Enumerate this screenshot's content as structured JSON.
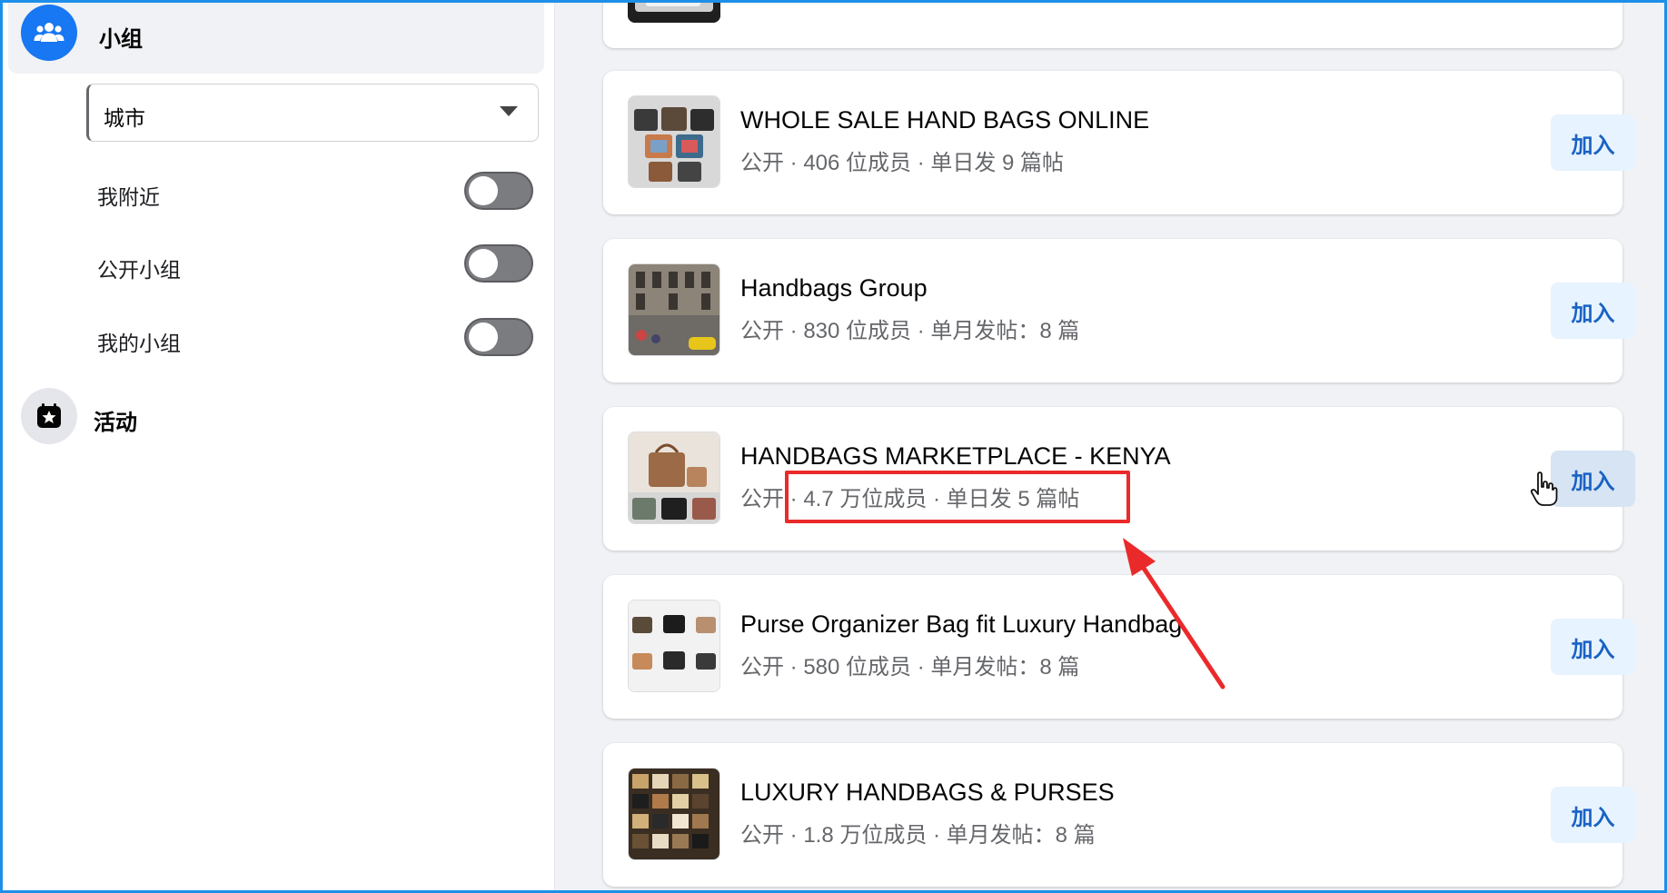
{
  "sidebar": {
    "groups": {
      "label": "小组",
      "icon": "groups-icon"
    },
    "city_filter": {
      "value": "城市",
      "icon": "caret-down-icon"
    },
    "toggles": [
      {
        "label": "我附近",
        "on": false
      },
      {
        "label": "公开小组",
        "on": false
      },
      {
        "label": "我的小组",
        "on": false
      }
    ],
    "events": {
      "label": "活动",
      "icon": "calendar-star-icon"
    }
  },
  "results": [
    {
      "title": "WHOLE SALE HAND BAGS ONLINE",
      "meta": "公开 · 406 位成员 · 单日发 9 篇帖",
      "join": "加入"
    },
    {
      "title": "Handbags Group",
      "meta": "公开 · 830 位成员 · 单月发帖：8 篇",
      "join": "加入"
    },
    {
      "title": "HANDBAGS MARKETPLACE - KENYA",
      "meta": "公开 · 4.7 万位成员 · 单日发 5 篇帖",
      "join": "加入"
    },
    {
      "title": "Purse Organizer Bag fit Luxury Handbag",
      "meta": "公开 · 580 位成员 · 单月发帖：8 篇",
      "join": "加入"
    },
    {
      "title": "LUXURY HANDBAGS & PURSES",
      "meta": "公开 · 1.8 万位成员 · 单月发帖：8 篇",
      "join": "加入"
    }
  ],
  "colors": {
    "frame_border": "#1d8fe8",
    "accent": "#1877f2",
    "join_button_bg": "#e7f3ff",
    "join_button_text": "#1a62c4",
    "annotation": "#ea2a2a"
  }
}
